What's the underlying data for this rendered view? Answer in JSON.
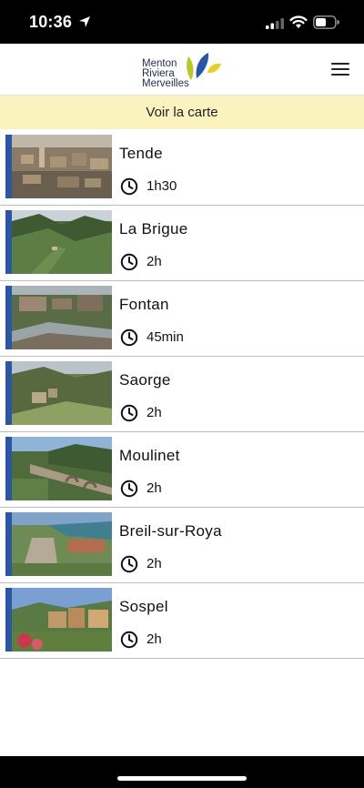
{
  "status_bar": {
    "time": "10:36"
  },
  "header": {
    "logo_lines": [
      "Menton",
      "Riviera",
      "Merveilles"
    ],
    "brand_colors": {
      "navy": "#1f2f4a",
      "blue": "#2a56a3",
      "yellow": "#e7cf2b",
      "green": "#b8c82a"
    },
    "menu_icon": "hamburger-menu-icon"
  },
  "map_banner": {
    "label": "Voir la carte",
    "background": "#faf3c0"
  },
  "accent_color": "#2a56a3",
  "items": [
    {
      "title": "Tende",
      "duration": "1h30"
    },
    {
      "title": "La Brigue",
      "duration": "2h"
    },
    {
      "title": "Fontan",
      "duration": "45min"
    },
    {
      "title": "Saorge",
      "duration": "2h"
    },
    {
      "title": "Moulinet",
      "duration": "2h"
    },
    {
      "title": "Breil-sur-Roya",
      "duration": "2h"
    },
    {
      "title": "Sospel",
      "duration": "2h"
    }
  ]
}
